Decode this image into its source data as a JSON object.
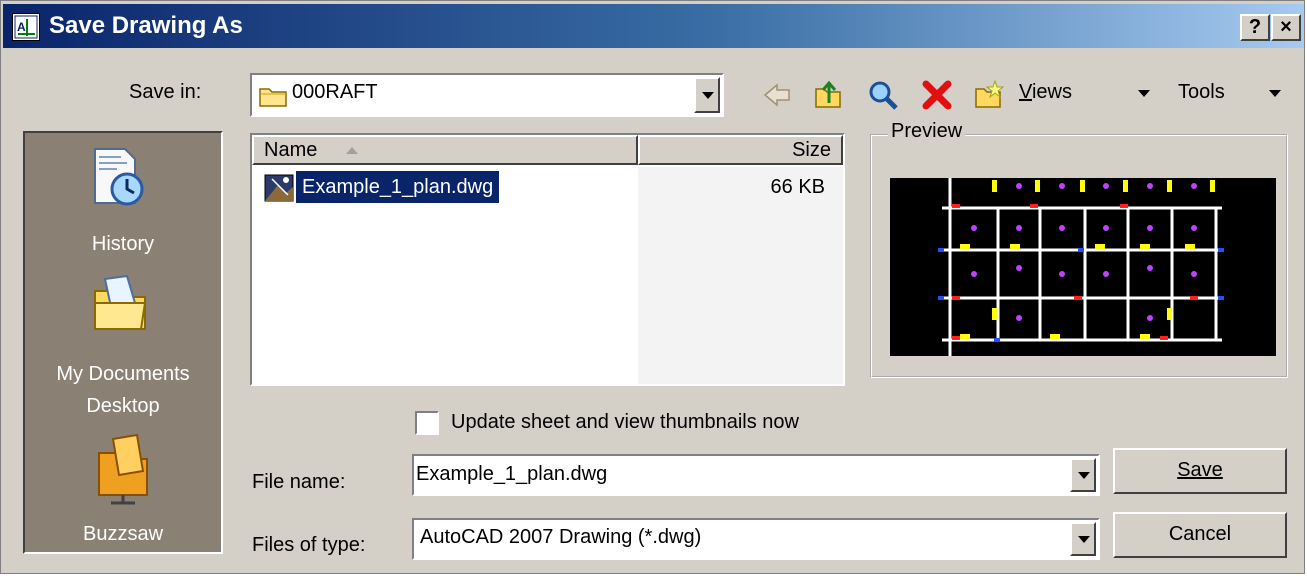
{
  "window": {
    "title": "Save Drawing As",
    "help_btn": "?",
    "close_btn": "×"
  },
  "toolbar": {
    "save_in_label": "Save in:",
    "save_in_value": "000RAFT",
    "views_label": "Views",
    "views_accel": "V",
    "tools_label": "Tools"
  },
  "places": [
    {
      "label": "History",
      "icon": "history-icon"
    },
    {
      "label": "My Documents",
      "icon": "my-documents-icon"
    },
    {
      "label": "Desktop",
      "icon": "desktop-icon"
    },
    {
      "label": "Buzzsaw",
      "icon": "buzzsaw-icon"
    }
  ],
  "file_list": {
    "columns": {
      "name": "Name",
      "size": "Size"
    },
    "rows": [
      {
        "name": "Example_1_plan.dwg",
        "size": "66 KB",
        "selected": true
      }
    ]
  },
  "preview": {
    "label": "Preview"
  },
  "thumbnails_checkbox": {
    "label": "Update sheet and view thumbnails now",
    "checked": false
  },
  "file_name": {
    "label": "File name:",
    "value": "Example_1_plan.dwg"
  },
  "file_type": {
    "label": "Files of type:",
    "value": "AutoCAD 2007 Drawing (*.dwg)"
  },
  "buttons": {
    "save": "Save",
    "cancel": "Cancel"
  },
  "colors": {
    "title_start": "#0a246a",
    "selection": "#0a246a",
    "dialog_bg": "#d4d0c8",
    "places_bg": "#8a8074"
  }
}
